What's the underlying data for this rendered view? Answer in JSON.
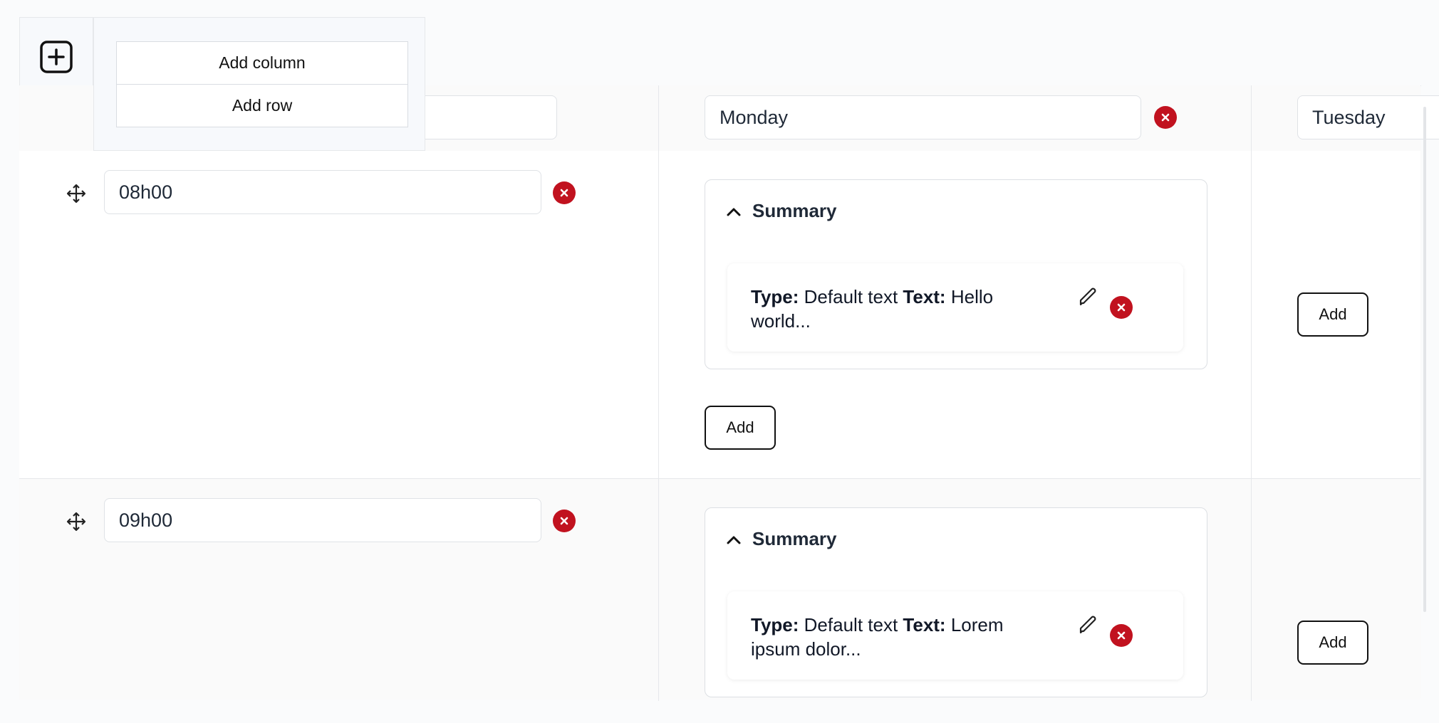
{
  "toolbar": {
    "add_icon": "plus-square-icon",
    "menu": [
      {
        "label": "Add column"
      },
      {
        "label": "Add row"
      }
    ]
  },
  "columns": [
    {
      "value": ""
    },
    {
      "value": "Monday"
    },
    {
      "value": "Tuesday"
    }
  ],
  "rows": [
    {
      "time": "08h00",
      "summary": {
        "title": "Summary",
        "item": {
          "type_label": "Type:",
          "type_value": "Default text",
          "text_label": "Text:",
          "text_value": "Hello world..."
        }
      },
      "add_label": "Add",
      "tuesday_add_label": "Add"
    },
    {
      "time": "09h00",
      "summary": {
        "title": "Summary",
        "item": {
          "type_label": "Type:",
          "type_value": "Default text",
          "text_label": "Text:",
          "text_value": "Lorem ipsum dolor..."
        }
      },
      "tuesday_add_label": "Add"
    }
  ],
  "colors": {
    "remove": "#c1121f",
    "border": "#e6e8eb",
    "accent_dark": "#111111"
  }
}
